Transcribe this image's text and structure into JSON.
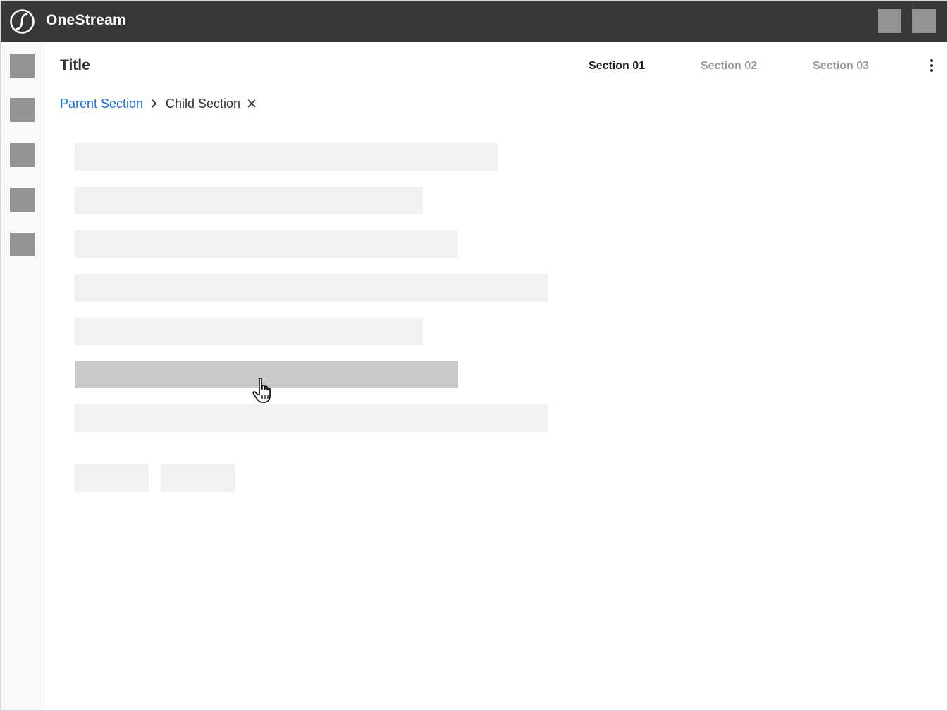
{
  "app": {
    "brand": "OneStream"
  },
  "header": {
    "icons": [
      "onestream-logo-icon",
      "header-action-1",
      "header-action-2"
    ],
    "colors": {
      "background": "#383838",
      "placeholder": "#939393"
    }
  },
  "sidebar": {
    "items": [
      "nav-placeholder-1",
      "nav-placeholder-2",
      "nav-placeholder-3",
      "nav-placeholder-4",
      "nav-placeholder-5"
    ]
  },
  "page": {
    "title": "Title",
    "tabs": [
      {
        "label": "Section 01",
        "active": true
      },
      {
        "label": "Section 02",
        "active": false
      },
      {
        "label": "Section 03",
        "active": false
      }
    ],
    "menu_icon": "more-vertical-icon"
  },
  "breadcrumb": {
    "parent": "Parent Section",
    "child": "Child Section",
    "separator_icon": "chevron-right-icon",
    "close_icon": "close-icon",
    "link_color": "#1e6ed8"
  },
  "content": {
    "rows": [
      "row-1",
      "row-2",
      "row-3",
      "row-4",
      "row-5",
      "row-6",
      "row-7"
    ],
    "hovered_row_index": 5,
    "buttons": [
      "placeholder-button-1",
      "placeholder-button-2"
    ],
    "colors": {
      "row": "#f1f1f1",
      "row_hover": "#cacaca"
    },
    "cursor_icon": "hand-pointer-icon"
  }
}
